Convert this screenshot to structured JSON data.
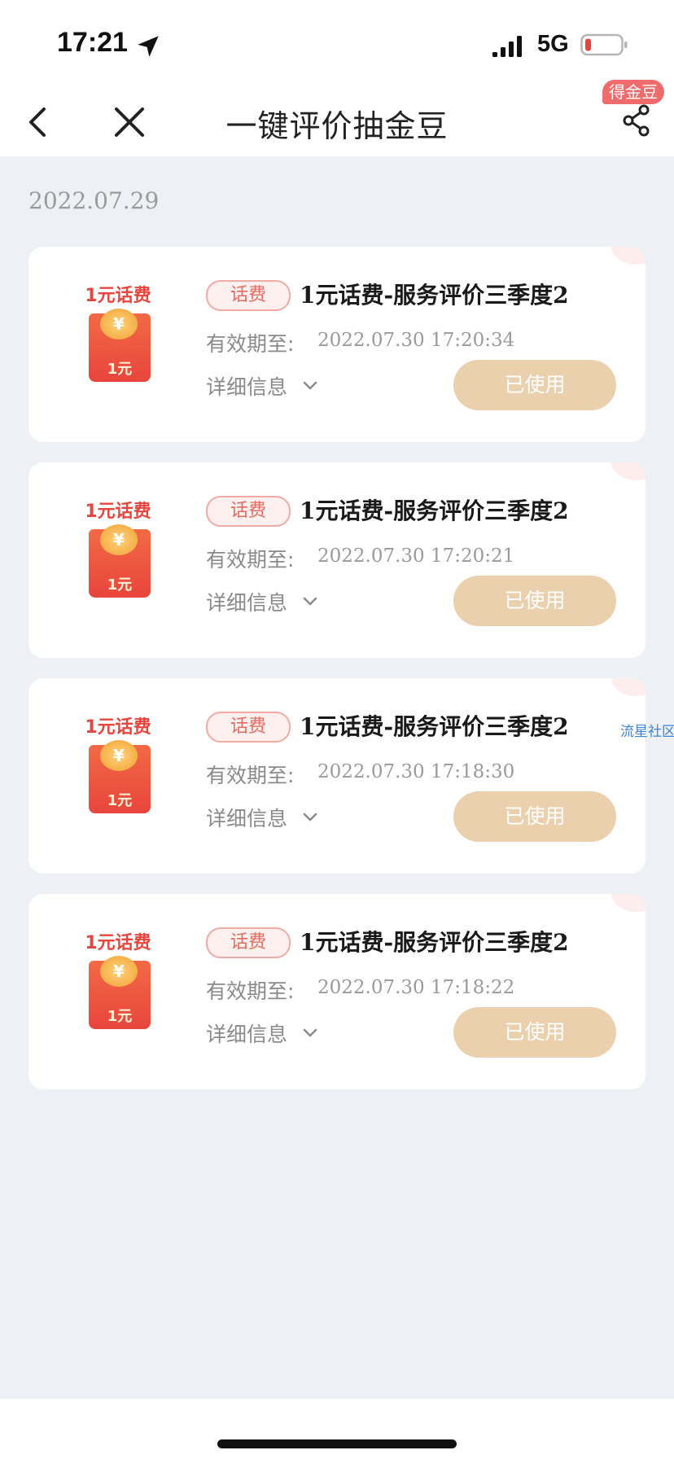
{
  "status_bar": {
    "time": "17:21",
    "network": "5G",
    "battery_color": "#e8453c"
  },
  "nav": {
    "title": "一键评价抽金豆",
    "share_badge": "得金豆"
  },
  "date_heading": "2022.07.29",
  "cards": [
    {
      "packet_caption": "1元话费",
      "packet_value": "1元",
      "tag": "话费",
      "title": "1元话费-服务评价三季度2",
      "expire_label": "有效期至:",
      "expire_value": "2022.07.30 17:20:34",
      "details_label": "详细信息",
      "button_label": "已使用"
    },
    {
      "packet_caption": "1元话费",
      "packet_value": "1元",
      "tag": "话费",
      "title": "1元话费-服务评价三季度2",
      "expire_label": "有效期至:",
      "expire_value": "2022.07.30 17:20:21",
      "details_label": "详细信息",
      "button_label": "已使用"
    },
    {
      "packet_caption": "1元话费",
      "packet_value": "1元",
      "tag": "话费",
      "title": "1元话费-服务评价三季度2",
      "expire_label": "有效期至:",
      "expire_value": "2022.07.30 17:18:30",
      "details_label": "详细信息",
      "button_label": "已使用"
    },
    {
      "packet_caption": "1元话费",
      "packet_value": "1元",
      "tag": "话费",
      "title": "1元话费-服务评价三季度2",
      "expire_label": "有效期至:",
      "expire_value": "2022.07.30 17:18:22",
      "details_label": "详细信息",
      "button_label": "已使用"
    }
  ],
  "watermark": "流星社区",
  "colors": {
    "accent_red": "#e8453c",
    "used_button": "#ead0ad",
    "page_bg": "#edf1f6"
  }
}
